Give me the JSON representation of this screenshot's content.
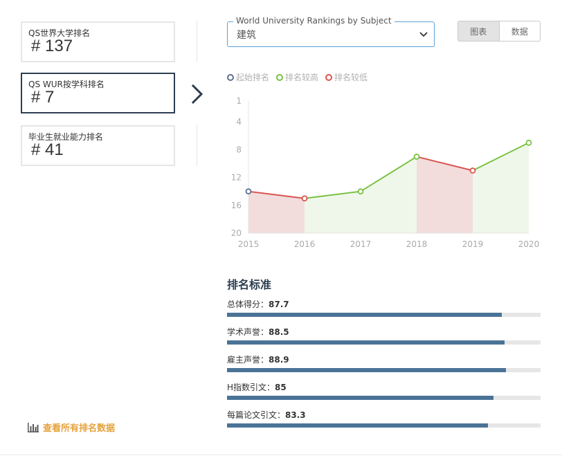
{
  "rankings": [
    {
      "label": "QS世界大学排名",
      "value": "# 137"
    },
    {
      "label": "QS WUR按学科排名",
      "value": "# 7"
    },
    {
      "label": "毕业生就业能力排名",
      "value": "# 41"
    }
  ],
  "all_rankings_link": "查看所有排名数据",
  "subject_select": {
    "legend": "World University Rankings by Subject",
    "value": "建筑"
  },
  "view_toggle": {
    "chart_label": "图表",
    "data_label": "数据",
    "selected": "图表"
  },
  "colors": {
    "start": "#5b6f8f",
    "higher": "#7ac143",
    "lower": "#d9534f",
    "bar": "#4a7396",
    "link": "#e6a23c"
  },
  "legend": [
    {
      "label": "起始排名",
      "color": "#5b6f8f"
    },
    {
      "label": "排名较高",
      "color": "#7ac143"
    },
    {
      "label": "排名较低",
      "color": "#d9534f"
    }
  ],
  "chart_data": {
    "type": "line",
    "x": [
      "2015",
      "2016",
      "2017",
      "2018",
      "2019",
      "2020"
    ],
    "values": [
      14,
      15,
      14,
      9,
      11,
      7
    ],
    "y_ticks": [
      1,
      4,
      8,
      12,
      16,
      20
    ],
    "ylim": [
      1,
      20
    ],
    "y_inverted": true,
    "segment_status": [
      "lower",
      "higher",
      "higher",
      "lower",
      "higher"
    ],
    "point_status": [
      "start",
      "lower",
      "higher",
      "higher",
      "lower",
      "higher"
    ]
  },
  "criteria": {
    "title": "排名标准",
    "items": [
      {
        "label": "总体得分：",
        "score": "87.7",
        "value": 87.7
      },
      {
        "label": "学术声誉：",
        "score": "88.5",
        "value": 88.5
      },
      {
        "label": "雇主声誉：",
        "score": "88.9",
        "value": 88.9
      },
      {
        "label": "H指数引文：",
        "score": "85",
        "value": 85
      },
      {
        "label": "每篇论文引文：",
        "score": "83.3",
        "value": 83.3
      }
    ]
  }
}
